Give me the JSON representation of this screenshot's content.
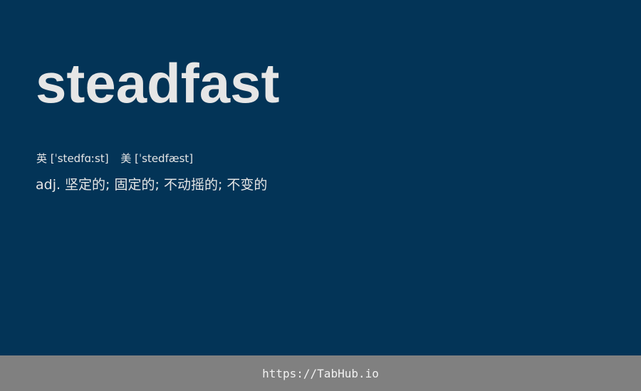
{
  "colors": {
    "background": "#033457",
    "text": "#e6e6e6",
    "footer_background": "#808080"
  },
  "entry": {
    "word": "steadfast",
    "phonetics": {
      "uk": "英 [ˈstedfɑːst]",
      "us": "美 [ˈstedfæst]"
    },
    "definition": "adj. 坚定的; 固定的; 不动摇的; 不变的"
  },
  "footer": {
    "link_text": "https://TabHub.io"
  }
}
